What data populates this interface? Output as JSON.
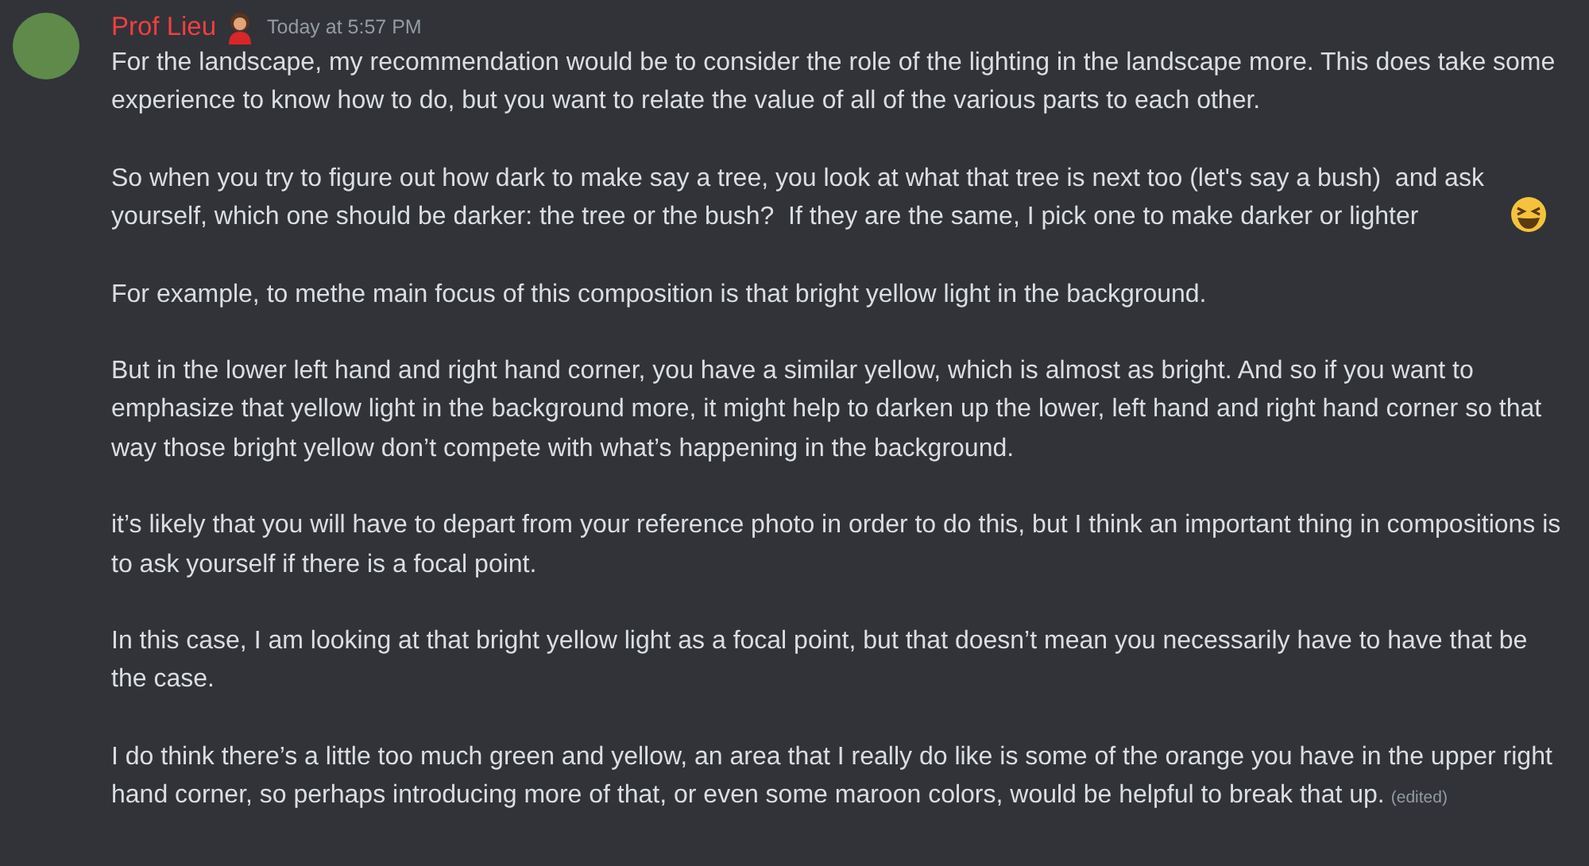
{
  "message": {
    "author": "Prof Lieu",
    "timestamp": "Today at 5:57 PM",
    "paragraphs": [
      {
        "text": "For the landscape, my recommendation would be to consider the role of the lighting in the landscape more. This does take some experience to know how to do, but you want to relate the value of all of the various parts to each other.",
        "trailing_emoji": false
      },
      {
        "text": "So when you try to figure out how dark to make say a tree, you look at what that tree is next too (let's say a bush)  and ask yourself, which one should be darker: the tree or the bush?  If they are the same, I pick one to make darker or lighter",
        "trailing_emoji": true
      },
      {
        "text": "For example, to methe main focus of this composition is that bright yellow light in the background.",
        "trailing_emoji": false
      },
      {
        "text": "But in the lower left hand and right hand corner, you have a similar yellow, which is almost as bright. And so if you want to emphasize that yellow light in the background more, it might help to darken up the lower, left hand and right hand corner so that way those bright yellow don’t compete with what’s happening in the background.",
        "trailing_emoji": false
      },
      {
        "text": "it’s likely that you will have to depart from your reference photo in order to do this, but I think an important thing in compositions is to ask yourself if there is a focal point.",
        "trailing_emoji": false
      },
      {
        "text": "In this case, I am looking at that bright yellow light as a focal point, but that doesn’t mean you necessarily have to have that be the case.",
        "trailing_emoji": false
      },
      {
        "text": "I do think there’s a little too much green and yellow, an area that I really do like is some of the orange you have in the upper right hand corner, so perhaps introducing more of that, or even some maroon colors, would be helpful to break that up.",
        "trailing_emoji": false
      }
    ],
    "edited_label": "(edited)"
  }
}
